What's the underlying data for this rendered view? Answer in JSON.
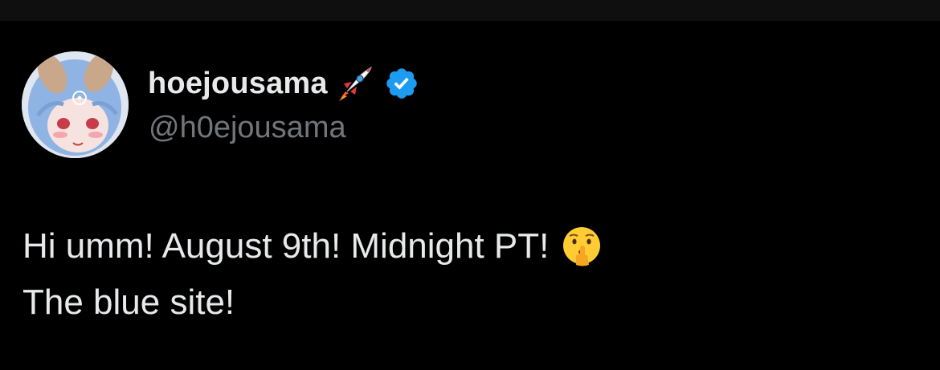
{
  "tweet": {
    "author": {
      "display_name": "hoejousama",
      "handle": "@h0ejousama",
      "name_emoji_icon": "rocket-icon",
      "verified_icon": "verified-badge-icon",
      "verified_color": "#1d9bf0"
    },
    "text_lines": [
      "Hi umm! August 9th! Midnight PT!",
      "The blue site!"
    ],
    "text_emoji_icon": "shushing-face-icon"
  },
  "colors": {
    "background": "#000000",
    "primary_text": "#e7e9ea",
    "secondary_text": "#71767b"
  }
}
